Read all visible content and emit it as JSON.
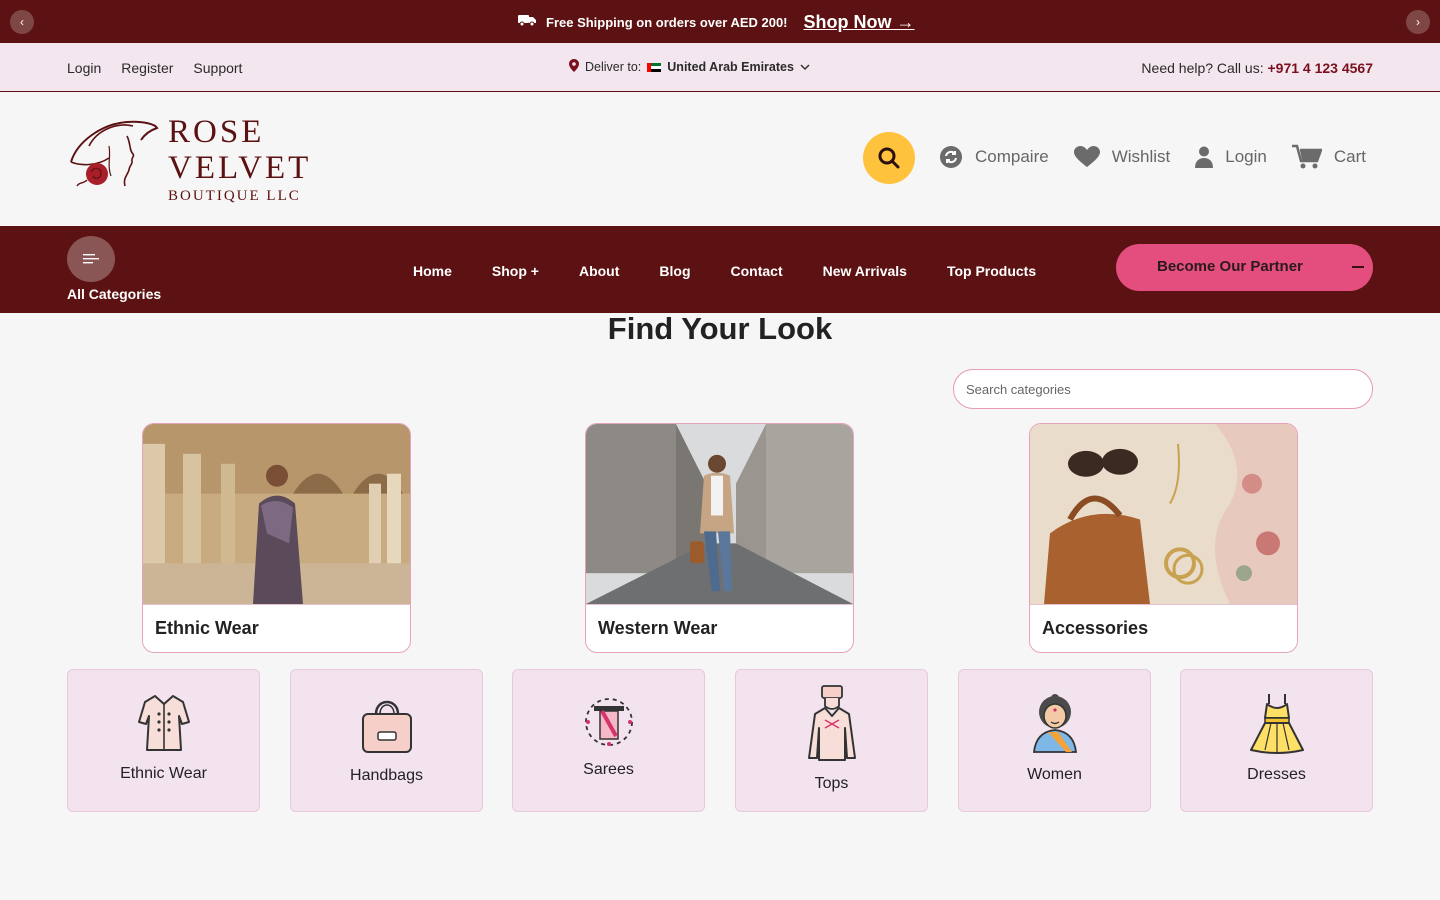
{
  "promo": {
    "prev_label": "‹",
    "next_label": "›",
    "message": "Free Shipping on orders over AED 200!",
    "cta": "Shop Now →"
  },
  "utility": {
    "links": [
      "Login",
      "Register",
      "Support"
    ],
    "deliver_label": "Deliver to:",
    "deliver_country": "United Arab Emirates",
    "help_label": "Need help? Call us:",
    "help_phone": "+971 4 123 4567"
  },
  "brand": {
    "line1": "ROSE",
    "line2": "VELVET",
    "line3": "BOUTIQUE LLC"
  },
  "header_actions": {
    "compare": "Compaire",
    "wishlist": "Wishlist",
    "login": "Login",
    "cart": "Cart"
  },
  "nav": {
    "all_categories": "All Categories",
    "items": [
      "Home",
      "Shop +",
      "About",
      "Blog",
      "Contact",
      "New Arrivals",
      "Top Products"
    ],
    "partner_button": "Become Our Partner"
  },
  "main": {
    "title": "Find Your Look",
    "search_placeholder": "Search categories",
    "featured": [
      {
        "label": "Ethnic Wear"
      },
      {
        "label": "Western Wear"
      },
      {
        "label": "Accessories"
      }
    ],
    "tiles": [
      {
        "label": "Ethnic Wear",
        "icon": "kurta-icon"
      },
      {
        "label": "Handbags",
        "icon": "handbag-icon"
      },
      {
        "label": "Sarees",
        "icon": "saree-icon"
      },
      {
        "label": "Tops",
        "icon": "tops-icon"
      },
      {
        "label": "Women",
        "icon": "woman-icon"
      },
      {
        "label": "Dresses",
        "icon": "dress-icon"
      }
    ]
  },
  "colors": {
    "maroon": "#5c1212",
    "accent_yellow": "#ffc23c",
    "partner_pink": "#e44e7e",
    "tile_bg": "#f3e3ef"
  }
}
